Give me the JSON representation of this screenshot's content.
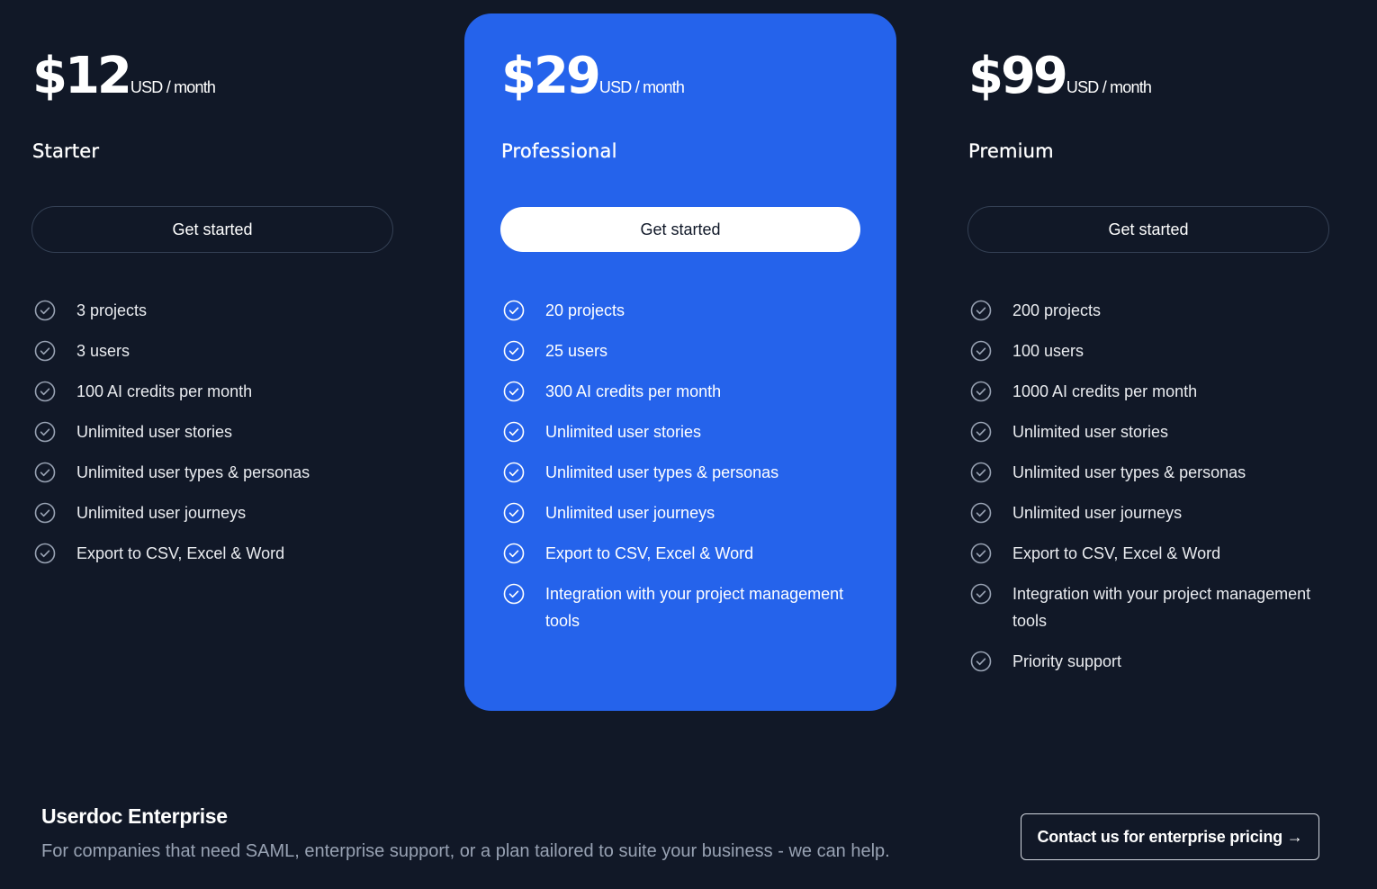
{
  "colors": {
    "background": "#111827",
    "highlight_card": "#2563eb",
    "muted_text": "#98a2b3"
  },
  "plans": [
    {
      "price": "$12",
      "unit": "USD / month",
      "name": "Starter",
      "cta_label": "Get started",
      "highlighted": false,
      "features": [
        "3 projects",
        "3 users",
        "100 AI credits per month",
        "Unlimited user stories",
        "Unlimited user types & personas",
        "Unlimited user journeys",
        "Export to CSV, Excel & Word"
      ]
    },
    {
      "price": "$29",
      "unit": "USD / month",
      "name": "Professional",
      "cta_label": "Get started",
      "highlighted": true,
      "features": [
        "20 projects",
        "25 users",
        "300 AI credits per month",
        "Unlimited user stories",
        "Unlimited user types & personas",
        "Unlimited user journeys",
        "Export to CSV, Excel & Word",
        "Integration with your project management tools"
      ]
    },
    {
      "price": "$99",
      "unit": "USD / month",
      "name": "Premium",
      "cta_label": "Get started",
      "highlighted": false,
      "features": [
        "200 projects",
        "100 users",
        "1000 AI credits per month",
        "Unlimited user stories",
        "Unlimited user types & personas",
        "Unlimited user journeys",
        "Export to CSV, Excel & Word",
        "Integration with your project management tools",
        "Priority support"
      ]
    }
  ],
  "enterprise": {
    "title": "Userdoc Enterprise",
    "description": "For companies that need SAML, enterprise support, or a plan tailored to suite your business - we can help.",
    "cta_label": "Contact us for enterprise pricing →"
  },
  "icons": {
    "feature_check": "check-circle-icon"
  }
}
